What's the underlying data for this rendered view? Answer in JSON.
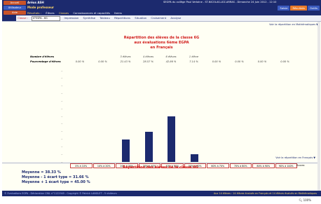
{
  "header": {
    "buttons": [
      "Accueil",
      "Utilisateur",
      "Aide"
    ],
    "app_title": "Aréus ASH",
    "app_sub": "Mode professeur",
    "school": "SEGPA du collège Paul Verlaine - ST-NICOLAS-LEZ-ARRAS - Dimanche 24 Juin 2012 - 12:10",
    "right_tabs": [
      "Saisie",
      "Résultats",
      "Outils"
    ],
    "menu": [
      "Résultats :",
      "Élèves",
      "Classes",
      "Connaissances et capacités",
      "Items"
    ]
  },
  "toolbar": {
    "classe_label": "Classe :",
    "classe_value": "6°ESPA - 6G",
    "items": [
      "Impression",
      "Synthèse",
      "Tableau",
      "Répartitions",
      "Situation",
      "Croisement",
      "Analyse"
    ]
  },
  "content": {
    "link_top": "Voir la répartition en Mathématiques ▼",
    "title_lines": [
      "Répartition des élèves de la classe 6G",
      "aux évaluations 6ème EGPA",
      "en Français"
    ],
    "nombre_label": "Nombre d'élèves",
    "pct_label": "Pourcentage d'élèves",
    "counts": [
      "",
      "",
      "3 élèves",
      "4 élèves",
      "6 élèves",
      "1 élève",
      "",
      "",
      "",
      ""
    ],
    "percents": [
      "0.00 %",
      "0.00 %",
      "21.43 %",
      "28.57 %",
      "42.86 %",
      "7.14 %",
      "0.00 %",
      "0.00 %",
      "0.00 %",
      "0.00 %"
    ],
    "scores_label": "Scores",
    "moyenne": "Moyenne = 38.33 %",
    "moins": "Moyenne - 1 écart type = 31.66 %",
    "plus": "Moyenne + 1 écart type = 45.00 %",
    "link_bottom": "Voir la répartition en Français ▼",
    "section2_title": "Répartition des élèves de la classe 6G"
  },
  "chart_data": {
    "type": "bar",
    "categories": [
      "0% à 10%",
      "10% à 20%",
      "20% à 30%",
      "30% à 40%",
      "40% à 50%",
      "50% à 60%",
      "60% à 70%",
      "70% à 80%",
      "80% à 90%",
      "90% à 100%"
    ],
    "values": [
      0,
      0,
      3,
      4,
      6,
      1,
      0,
      0,
      0,
      0
    ],
    "ylim": [
      0,
      12
    ],
    "xlabel": "Scores",
    "bar_color": "#1c2a6e"
  },
  "status": {
    "left": "© Evaluations EGPA - Déclaration CNIL n°1122945 - Copyright © Patrick LANGLET - 5 visiteurs",
    "right": "Aux 14 élèves : 14 élèves évalués en Français et 14 élèves évalués en Mathématiques",
    "zoom": "100%"
  }
}
